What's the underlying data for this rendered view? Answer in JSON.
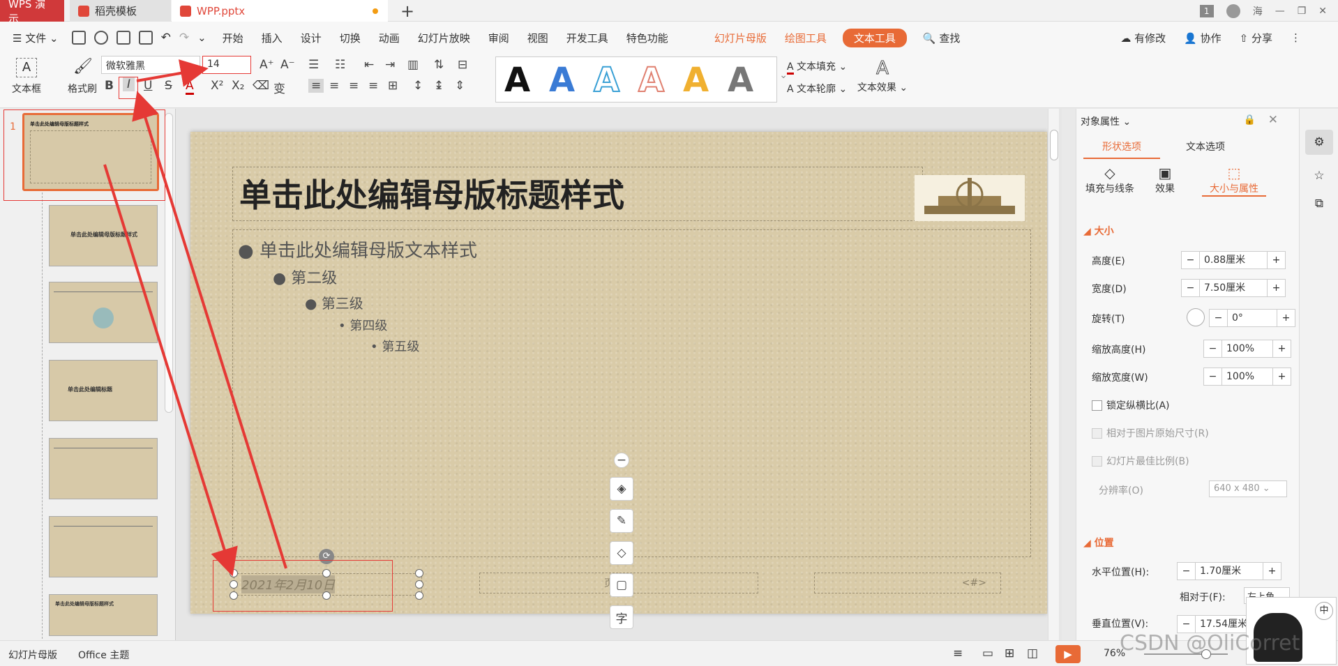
{
  "titlebar": {
    "app_tab": "WPS 演示",
    "template_tab": "稻壳模板",
    "file_tab": "WPP.pptx",
    "new_tab_icon": "plus-icon",
    "badge": "1",
    "user": "海"
  },
  "menubar": {
    "file_menu": "文件",
    "items": [
      "开始",
      "插入",
      "设计",
      "切换",
      "动画",
      "幻灯片放映",
      "审阅",
      "视图",
      "开发工具",
      "特色功能"
    ],
    "context_items": [
      "幻灯片母版",
      "绘图工具"
    ],
    "active_item": "文本工具",
    "search": "查找",
    "right_items": [
      "有修改",
      "协作",
      "分享"
    ]
  },
  "ribbon": {
    "textbox_label": "文本框",
    "format_painter_label": "格式刷",
    "font_name": "微软雅黑",
    "font_size": "14",
    "style_letter": "A",
    "text_fill": "文本填充",
    "text_outline": "文本轮廓",
    "text_effect": "文本效果",
    "bold": "B",
    "italic": "I",
    "underline": "U",
    "strike": "S",
    "font_color": "A",
    "superscript": "X²",
    "subscript": "X₂",
    "case_change": "变"
  },
  "thumbnails": {
    "slide_number": "1",
    "master_title": "单击此处编辑母版标题样式",
    "layout_title": "单击此处编辑标题",
    "thumb_title": "单击此处编辑母版标题样式"
  },
  "slide": {
    "title": "单击此处编辑母版标题样式",
    "levels": [
      "单击此处编辑母版文本样式",
      "第二级",
      "第三级",
      "第四级",
      "第五级"
    ],
    "date": "2021年2月10日",
    "footer": "页脚区",
    "number": "<#>"
  },
  "floattools": {
    "collapse": "−",
    "text": "字"
  },
  "props": {
    "header": "对象属性",
    "tabs": [
      "形状选项",
      "文本选项"
    ],
    "subtabs": [
      "填充与线条",
      "效果",
      "大小与属性"
    ],
    "size_section": "大小",
    "height_label": "高度(E)",
    "height_val": "0.88厘米",
    "width_label": "宽度(D)",
    "width_val": "7.50厘米",
    "rotate_label": "旋转(T)",
    "rotate_val": "0°",
    "scale_h_label": "缩放高度(H)",
    "scale_h_val": "100%",
    "scale_w_label": "缩放宽度(W)",
    "scale_w_val": "100%",
    "lock_ratio": "锁定纵横比(A)",
    "relative_orig": "相对于图片原始尺寸(R)",
    "best_ratio": "幻灯片最佳比例(B)",
    "resolution_label": "分辨率(O)",
    "resolution_val": "640 x 480",
    "position_section": "位置",
    "hpos_label": "水平位置(H):",
    "hpos_val": "1.70厘米",
    "relative_label": "相对于(F):",
    "relative_val": "左上角",
    "vpos_label": "垂直位置(V):",
    "vpos_val": "17.54厘米"
  },
  "statusbar": {
    "mode": "幻灯片母版",
    "theme": "Office 主题",
    "zoom": "76%"
  },
  "watermark": "CSDN @OliCorret",
  "colors": {
    "accent": "#e86a36",
    "wps_red": "#d0393a",
    "annotation": "#e53935"
  }
}
